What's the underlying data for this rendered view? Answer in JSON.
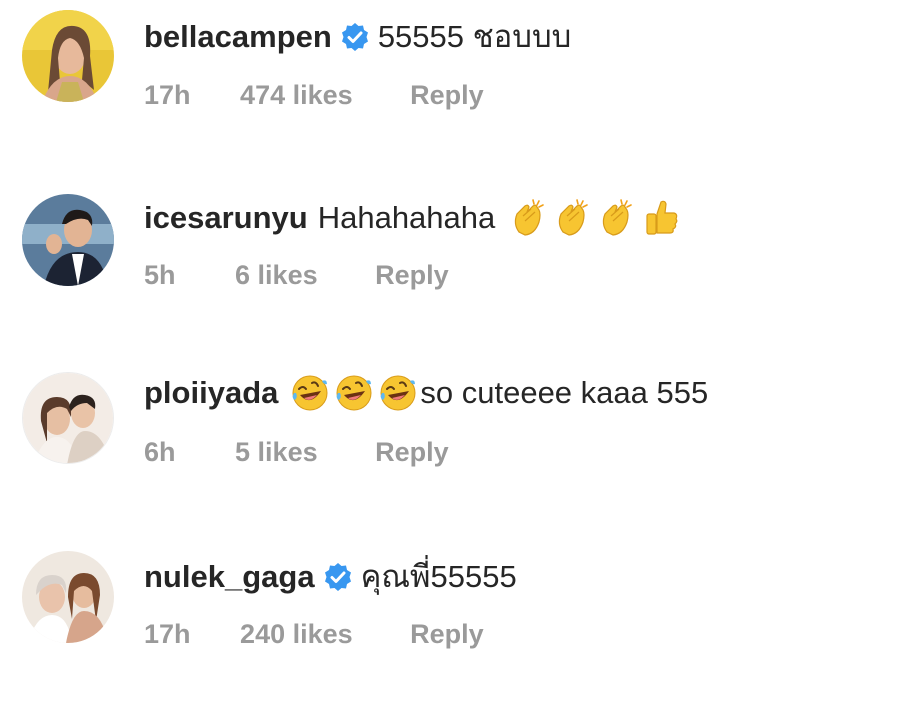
{
  "comments": [
    {
      "username": "bellacampen",
      "verified": true,
      "text": "55555 ชอบบบ",
      "time": "17h",
      "likes": "474 likes",
      "reply": "Reply",
      "avatar_icon": "avatar-woman-yellow"
    },
    {
      "username": "icesarunyu",
      "verified": false,
      "text": "Hahahahaha",
      "emojis": [
        "clapping-hands-emoji",
        "clapping-hands-emoji",
        "clapping-hands-emoji",
        "thumbs-up-emoji"
      ],
      "time": "5h",
      "likes": "6 likes",
      "reply": "Reply",
      "avatar_icon": "avatar-man-suit"
    },
    {
      "username": "ploiiyada",
      "verified": false,
      "emojis": [
        "rofl-emoji",
        "rofl-emoji",
        "rofl-emoji"
      ],
      "text": "so cuteeee kaaa 555",
      "time": "6h",
      "likes": "5 likes",
      "reply": "Reply",
      "avatar_icon": "avatar-couple"
    },
    {
      "username": "nulek_gaga",
      "verified": true,
      "text": "คุณพี่55555",
      "time": "17h",
      "likes": "240 likes",
      "reply": "Reply",
      "avatar_icon": "avatar-two-women"
    }
  ],
  "colors": {
    "username": "#262626",
    "meta": "#9a9a9a",
    "verified_badge": "#3897f0",
    "emoji_yellow": "#f7c531"
  }
}
